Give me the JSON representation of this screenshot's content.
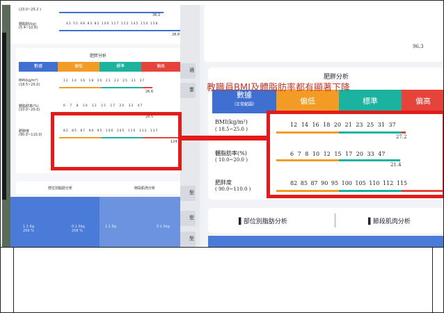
{
  "overlay_caption": "教職員BMI及體脂肪率都有顯著下降",
  "right_card": {
    "title": "肥胖分析",
    "col_header_main": "數據",
    "col_header_sub": "（正常範圍）",
    "col_low": "偏低",
    "col_normal": "標準",
    "col_high": "偏高",
    "rows": [
      {
        "label": "BMI(kg/m²)",
        "range": "( 18.5~25.0 )",
        "ticks": "12   14   16   18   20   21   23   25   31   37",
        "value": "27.2",
        "fraction": 0.68
      },
      {
        "label": "體脂肪率(%)",
        "range": "( 10.0~20.0 )",
        "ticks": "6    7    8    10   12   15   17   20   33   47",
        "value": "21.4",
        "fraction": 0.6
      },
      {
        "label": "肥胖度",
        "range": "( 90.0~110.0 )",
        "ticks": "82   85   87   90   95   100  105  110  112  115",
        "value": "",
        "fraction": 0.82
      }
    ],
    "bottom_left": "部位別脂肪分析",
    "bottom_right": "節段肌肉分析",
    "top_value": "96.3"
  },
  "left_panel": {
    "top_row1": "(23.0~25.2 )",
    "top_row1_value": "38.2",
    "top_row2_label": "體脂肪(kg)",
    "top_row2_range": "(5.4~10.8)",
    "top_row2_ticks": "42  55  68  83  82  100  117  122  145  150  158",
    "top_row2_value": "28.8",
    "card_title": "肥胖分析",
    "hdr_data": "數據",
    "hdr_low": "偏低",
    "hdr_normal": "標準",
    "hdr_high": "偏高",
    "rows": [
      {
        "label": "BMI(kg/m²)",
        "range": "(18.5~25.0)",
        "ticks": "12 14 16 18 20 21 23 25 31 37",
        "value": "26.6"
      },
      {
        "label": "體脂肪率(%)",
        "range": "(10.0~20.0)",
        "ticks": "6 7 8 10 12 15 17 20 33 47",
        "value": "28.5"
      },
      {
        "label": "肥胖度",
        "range": "(90.0~110.0)",
        "ticks": "82 85 87 90 95 100 105 110 112 117",
        "value": "124"
      }
    ],
    "bottom_left": "部位別脂肪分析",
    "bottom_right": "節段肌肉分析",
    "blue_left_a": "1.1 Kg",
    "blue_left_b": "256 %",
    "blue_mid_a": "0.1.5kg",
    "blue_mid_b": "256 %",
    "blue_right_a": "1.1 Kg",
    "blue_right_b": "0.1.5kg"
  },
  "mid_tabs": [
    "適",
    "羣",
    "型",
    "型",
    "型"
  ],
  "colors": {
    "blue": "#3f6fd1",
    "orange": "#f29c26",
    "teal": "#1bb3a0",
    "red": "#e6443a",
    "frame_red": "#e31b1b"
  }
}
